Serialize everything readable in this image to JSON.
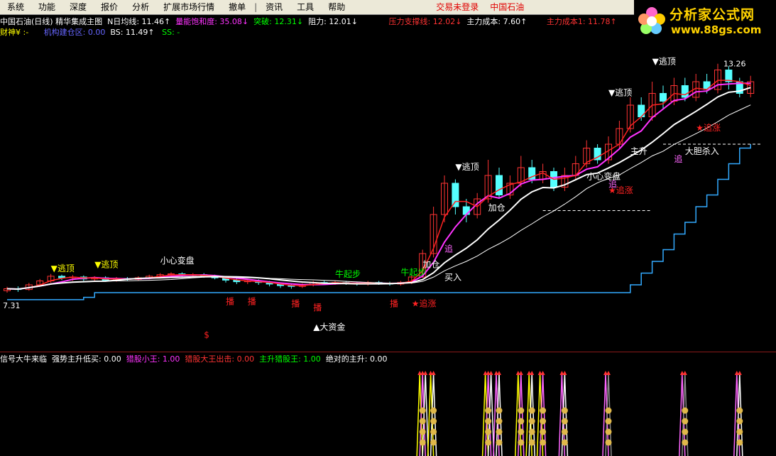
{
  "menu": {
    "items": [
      "系统",
      "功能",
      "深度",
      "报价",
      "分析",
      "扩展市场行情",
      "撤单",
      "资讯",
      "工具",
      "帮助"
    ],
    "login_status": "交易未登录",
    "stock_name": "中国石油"
  },
  "logo": {
    "title": "分析家公式网",
    "url": "www.88gs.com"
  },
  "header": {
    "row1": [
      {
        "text": "中国石油(日线) 精华集成主图",
        "color": "#ffffff"
      },
      {
        "text": "N日均线: 11.46↑",
        "color": "#ffffff"
      },
      {
        "text": "量能饱和度: 35.08↓",
        "color": "#ff33ff"
      },
      {
        "text": "突破: 12.31↓",
        "color": "#00ff00"
      },
      {
        "text": "阻力: 12.01↓",
        "color": "#ffffff"
      },
      {
        "text": "压力支撑线: 12.02↓",
        "color": "#ff3333"
      },
      {
        "text": "主力成本: 7.60↑",
        "color": "#ffffff"
      },
      {
        "text": "主力成本1: 11.78↑",
        "color": "#ff3333"
      }
    ],
    "row2": [
      {
        "text": "财神¥ :-",
        "color": "#ffff00"
      },
      {
        "text": "机构建仓区: 0.00",
        "color": "#6666ff"
      },
      {
        "text": "BS: 11.49↑",
        "color": "#ffffff"
      },
      {
        "text": "SS: -",
        "color": "#00ff00"
      }
    ],
    "sub_row": [
      {
        "text": "信号大牛来临",
        "color": "#ffffff"
      },
      {
        "text": "强势主升低买: 0.00",
        "color": "#ffffff"
      },
      {
        "text": "猎股小王: 1.00",
        "color": "#ff33ff"
      },
      {
        "text": "猎股大王出击: 0.00",
        "color": "#ff3333"
      },
      {
        "text": "主升猎股王: 1.00",
        "color": "#00ff00"
      },
      {
        "text": "绝对的主升: 0.00",
        "color": "#ffffff"
      }
    ]
  },
  "chart_data": {
    "type": "candlestick",
    "high_label": "13.26",
    "low_label": "7.31",
    "candles": [
      [
        7.45,
        7.5,
        7.4,
        7.55
      ],
      [
        7.5,
        7.48,
        7.42,
        7.56
      ],
      [
        7.48,
        7.6,
        7.45,
        7.65
      ],
      [
        7.6,
        7.7,
        7.55,
        7.75
      ],
      [
        7.7,
        7.82,
        7.65,
        7.88
      ],
      [
        7.82,
        7.78,
        7.72,
        7.86
      ],
      [
        7.78,
        7.8,
        7.7,
        7.85
      ],
      [
        7.8,
        7.75,
        7.7,
        7.84
      ],
      [
        7.75,
        7.78,
        7.7,
        7.82
      ],
      [
        7.78,
        7.72,
        7.68,
        7.82
      ],
      [
        7.72,
        7.76,
        7.68,
        7.8
      ],
      [
        7.76,
        7.74,
        7.7,
        7.8
      ],
      [
        7.74,
        7.78,
        7.7,
        7.82
      ],
      [
        7.78,
        7.82,
        7.74,
        7.86
      ],
      [
        7.82,
        7.86,
        7.78,
        7.9
      ],
      [
        7.86,
        7.88,
        7.82,
        7.92
      ],
      [
        7.88,
        7.84,
        7.8,
        7.92
      ],
      [
        7.84,
        7.86,
        7.8,
        7.9
      ],
      [
        7.86,
        7.82,
        7.78,
        7.9
      ],
      [
        7.82,
        7.78,
        7.74,
        7.86
      ],
      [
        7.78,
        7.72,
        7.66,
        7.82
      ],
      [
        7.72,
        7.68,
        7.62,
        7.76
      ],
      [
        7.68,
        7.7,
        7.62,
        7.74
      ],
      [
        7.7,
        7.66,
        7.6,
        7.74
      ],
      [
        7.66,
        7.62,
        7.56,
        7.7
      ],
      [
        7.62,
        7.58,
        7.52,
        7.66
      ],
      [
        7.58,
        7.56,
        7.5,
        7.64
      ],
      [
        7.56,
        7.6,
        7.52,
        7.64
      ],
      [
        7.6,
        7.66,
        7.56,
        7.7
      ],
      [
        7.66,
        7.64,
        7.6,
        7.7
      ],
      [
        7.64,
        7.66,
        7.6,
        7.7
      ],
      [
        7.66,
        7.64,
        7.6,
        7.7
      ],
      [
        7.64,
        7.62,
        7.58,
        7.68
      ],
      [
        7.62,
        7.66,
        7.58,
        7.7
      ],
      [
        7.66,
        7.64,
        7.6,
        7.7
      ],
      [
        7.64,
        7.62,
        7.58,
        7.68
      ],
      [
        7.62,
        7.66,
        7.58,
        7.7
      ],
      [
        7.66,
        7.8,
        7.62,
        7.86
      ],
      [
        7.8,
        8.4,
        7.78,
        8.5
      ],
      [
        8.4,
        9.4,
        8.3,
        9.6
      ],
      [
        9.4,
        10.2,
        9.2,
        10.4
      ],
      [
        10.2,
        9.6,
        9.4,
        10.3
      ],
      [
        9.6,
        9.4,
        9.2,
        9.8
      ],
      [
        9.4,
        9.8,
        9.3,
        9.95
      ],
      [
        9.8,
        10.4,
        9.7,
        10.8
      ],
      [
        10.4,
        9.9,
        9.8,
        10.6
      ],
      [
        9.9,
        10.2,
        9.8,
        10.4
      ],
      [
        10.2,
        10.6,
        10.1,
        10.9
      ],
      [
        10.6,
        10.3,
        10.2,
        10.8
      ],
      [
        10.3,
        10.5,
        10.2,
        10.7
      ],
      [
        10.5,
        10.1,
        10.0,
        10.6
      ],
      [
        10.1,
        10.4,
        10.0,
        10.6
      ],
      [
        10.4,
        10.7,
        10.3,
        10.9
      ],
      [
        10.7,
        11.1,
        10.6,
        11.3
      ],
      [
        11.1,
        10.8,
        10.7,
        11.2
      ],
      [
        10.8,
        11.2,
        10.7,
        11.4
      ],
      [
        11.2,
        11.6,
        11.1,
        11.8
      ],
      [
        11.6,
        12.2,
        11.5,
        12.4
      ],
      [
        12.2,
        11.9,
        11.8,
        12.4
      ],
      [
        11.9,
        12.5,
        11.8,
        12.8
      ],
      [
        12.5,
        12.3,
        12.1,
        12.7
      ],
      [
        12.3,
        12.7,
        12.2,
        12.9
      ],
      [
        12.7,
        12.4,
        12.3,
        12.9
      ],
      [
        12.4,
        12.8,
        12.3,
        13.0
      ],
      [
        12.8,
        12.6,
        12.5,
        13.0
      ],
      [
        12.6,
        13.1,
        12.5,
        13.26
      ],
      [
        13.1,
        12.8,
        12.6,
        13.2
      ],
      [
        12.8,
        12.5,
        12.4,
        12.9
      ],
      [
        12.5,
        12.8,
        12.4,
        12.95
      ]
    ],
    "support_line": [
      7.22,
      7.22,
      7.22,
      7.22,
      7.22,
      7.22,
      7.22,
      7.28,
      7.4,
      7.4,
      7.4,
      7.4,
      7.4,
      7.4,
      7.4,
      7.4,
      7.4,
      7.4,
      7.4,
      7.4,
      7.4,
      7.4,
      7.4,
      7.4,
      7.4,
      7.4,
      7.4,
      7.4,
      7.4,
      7.4,
      7.4,
      7.4,
      7.4,
      7.4,
      7.4,
      7.4,
      7.4,
      7.4,
      7.4,
      7.4,
      7.4,
      7.4,
      7.4,
      7.4,
      7.4,
      7.4,
      7.4,
      7.4,
      7.4,
      7.4,
      7.4,
      7.4,
      7.4,
      7.4,
      7.4,
      7.4,
      7.4,
      7.6,
      7.9,
      8.2,
      8.5,
      8.9,
      9.2,
      9.6,
      9.9,
      10.3,
      10.7,
      11.1,
      11.2
    ],
    "labels": [
      {
        "text": "▼逃顶",
        "color": "#ffff00",
        "i": 4,
        "v": 7.95
      },
      {
        "text": "▼逃顶",
        "color": "#ffff00",
        "i": 8,
        "v": 8.05
      },
      {
        "text": "▼逃顶",
        "color": "#ffffff",
        "i": 41,
        "v": 10.55
      },
      {
        "text": "▼逃顶",
        "color": "#ffffff",
        "i": 55,
        "v": 12.45
      },
      {
        "text": "▼逃顶",
        "color": "#ffffff",
        "i": 59,
        "v": 13.25
      },
      {
        "text": "小心变盘",
        "color": "#ffffff",
        "i": 14,
        "v": 8.15
      },
      {
        "text": "小心变盘",
        "color": "#ffffff",
        "i": 53,
        "v": 10.3
      },
      {
        "text": "牛起步",
        "color": "#00ff00",
        "i": 30,
        "v": 7.8
      },
      {
        "text": "牛起步",
        "color": "#00ff00",
        "i": 36,
        "v": 7.85
      },
      {
        "text": "加仓",
        "color": "#ffffff",
        "i": 38,
        "v": 8.05
      },
      {
        "text": "加仓",
        "color": "#ffffff",
        "i": 44,
        "v": 9.5
      },
      {
        "text": "★追涨",
        "color": "#ff2222",
        "i": 37,
        "v": 7.05
      },
      {
        "text": "★追涨",
        "color": "#ff2222",
        "i": 55,
        "v": 9.95
      },
      {
        "text": "★追涨",
        "color": "#ff2222",
        "i": 63,
        "v": 11.55
      },
      {
        "text": "追",
        "color": "#ff66ff",
        "i": 40,
        "v": 8.45
      },
      {
        "text": "追",
        "color": "#ff66ff",
        "i": 55,
        "v": 10.1
      },
      {
        "text": "追",
        "color": "#ff66ff",
        "i": 61,
        "v": 10.75
      },
      {
        "text": "主升",
        "color": "#ffffff",
        "i": 57,
        "v": 10.95
      },
      {
        "text": "大胆杀入",
        "color": "#ffffff",
        "i": 62,
        "v": 10.95
      },
      {
        "text": "买入",
        "color": "#ffffff",
        "i": 40,
        "v": 7.72
      },
      {
        "text": "▲大资金",
        "color": "#ffffff",
        "i": 28,
        "v": 6.45
      },
      {
        "text": "播",
        "color": "#ff2222",
        "i": 20,
        "v": 7.1
      },
      {
        "text": "播",
        "color": "#ff2222",
        "i": 22,
        "v": 7.1
      },
      {
        "text": "播",
        "color": "#ff2222",
        "i": 26,
        "v": 7.05
      },
      {
        "text": "播",
        "color": "#ff2222",
        "i": 28,
        "v": 6.95
      },
      {
        "text": "播",
        "color": "#ff2222",
        "i": 35,
        "v": 7.05
      },
      {
        "text": "$",
        "color": "#ff2222",
        "i": 18,
        "v": 6.25
      }
    ],
    "signal_bars": [
      {
        "i": 38,
        "colors": [
          "#ffff00",
          "#ff66ff",
          "#ffffff"
        ]
      },
      {
        "i": 39,
        "colors": [
          "#ffff00",
          "#ffffff"
        ]
      },
      {
        "i": 44,
        "colors": [
          "#ffff00",
          "#ff66ff",
          "#ffffff"
        ]
      },
      {
        "i": 45,
        "colors": [
          "#ff66ff",
          "#ffffff"
        ]
      },
      {
        "i": 47,
        "colors": [
          "#ffff00",
          "#ff66ff"
        ]
      },
      {
        "i": 48,
        "colors": [
          "#ffff00",
          "#ffffff"
        ]
      },
      {
        "i": 49,
        "colors": [
          "#ffff00",
          "#ff66ff"
        ]
      },
      {
        "i": 51,
        "colors": [
          "#ff66ff",
          "#ffffff"
        ]
      },
      {
        "i": 55,
        "colors": [
          "#ff66ff",
          "#888888"
        ]
      },
      {
        "i": 62,
        "colors": [
          "#ff66ff",
          "#888888"
        ]
      },
      {
        "i": 67,
        "colors": [
          "#ff66ff",
          "#ffffff"
        ]
      }
    ],
    "colors": {
      "up": "#ff3333",
      "down": "#55ffff",
      "support": "#33aaff",
      "ma_fast": "#ff33ff",
      "ma_slow": "#ffffff",
      "ma_red": "#ff2222"
    }
  }
}
